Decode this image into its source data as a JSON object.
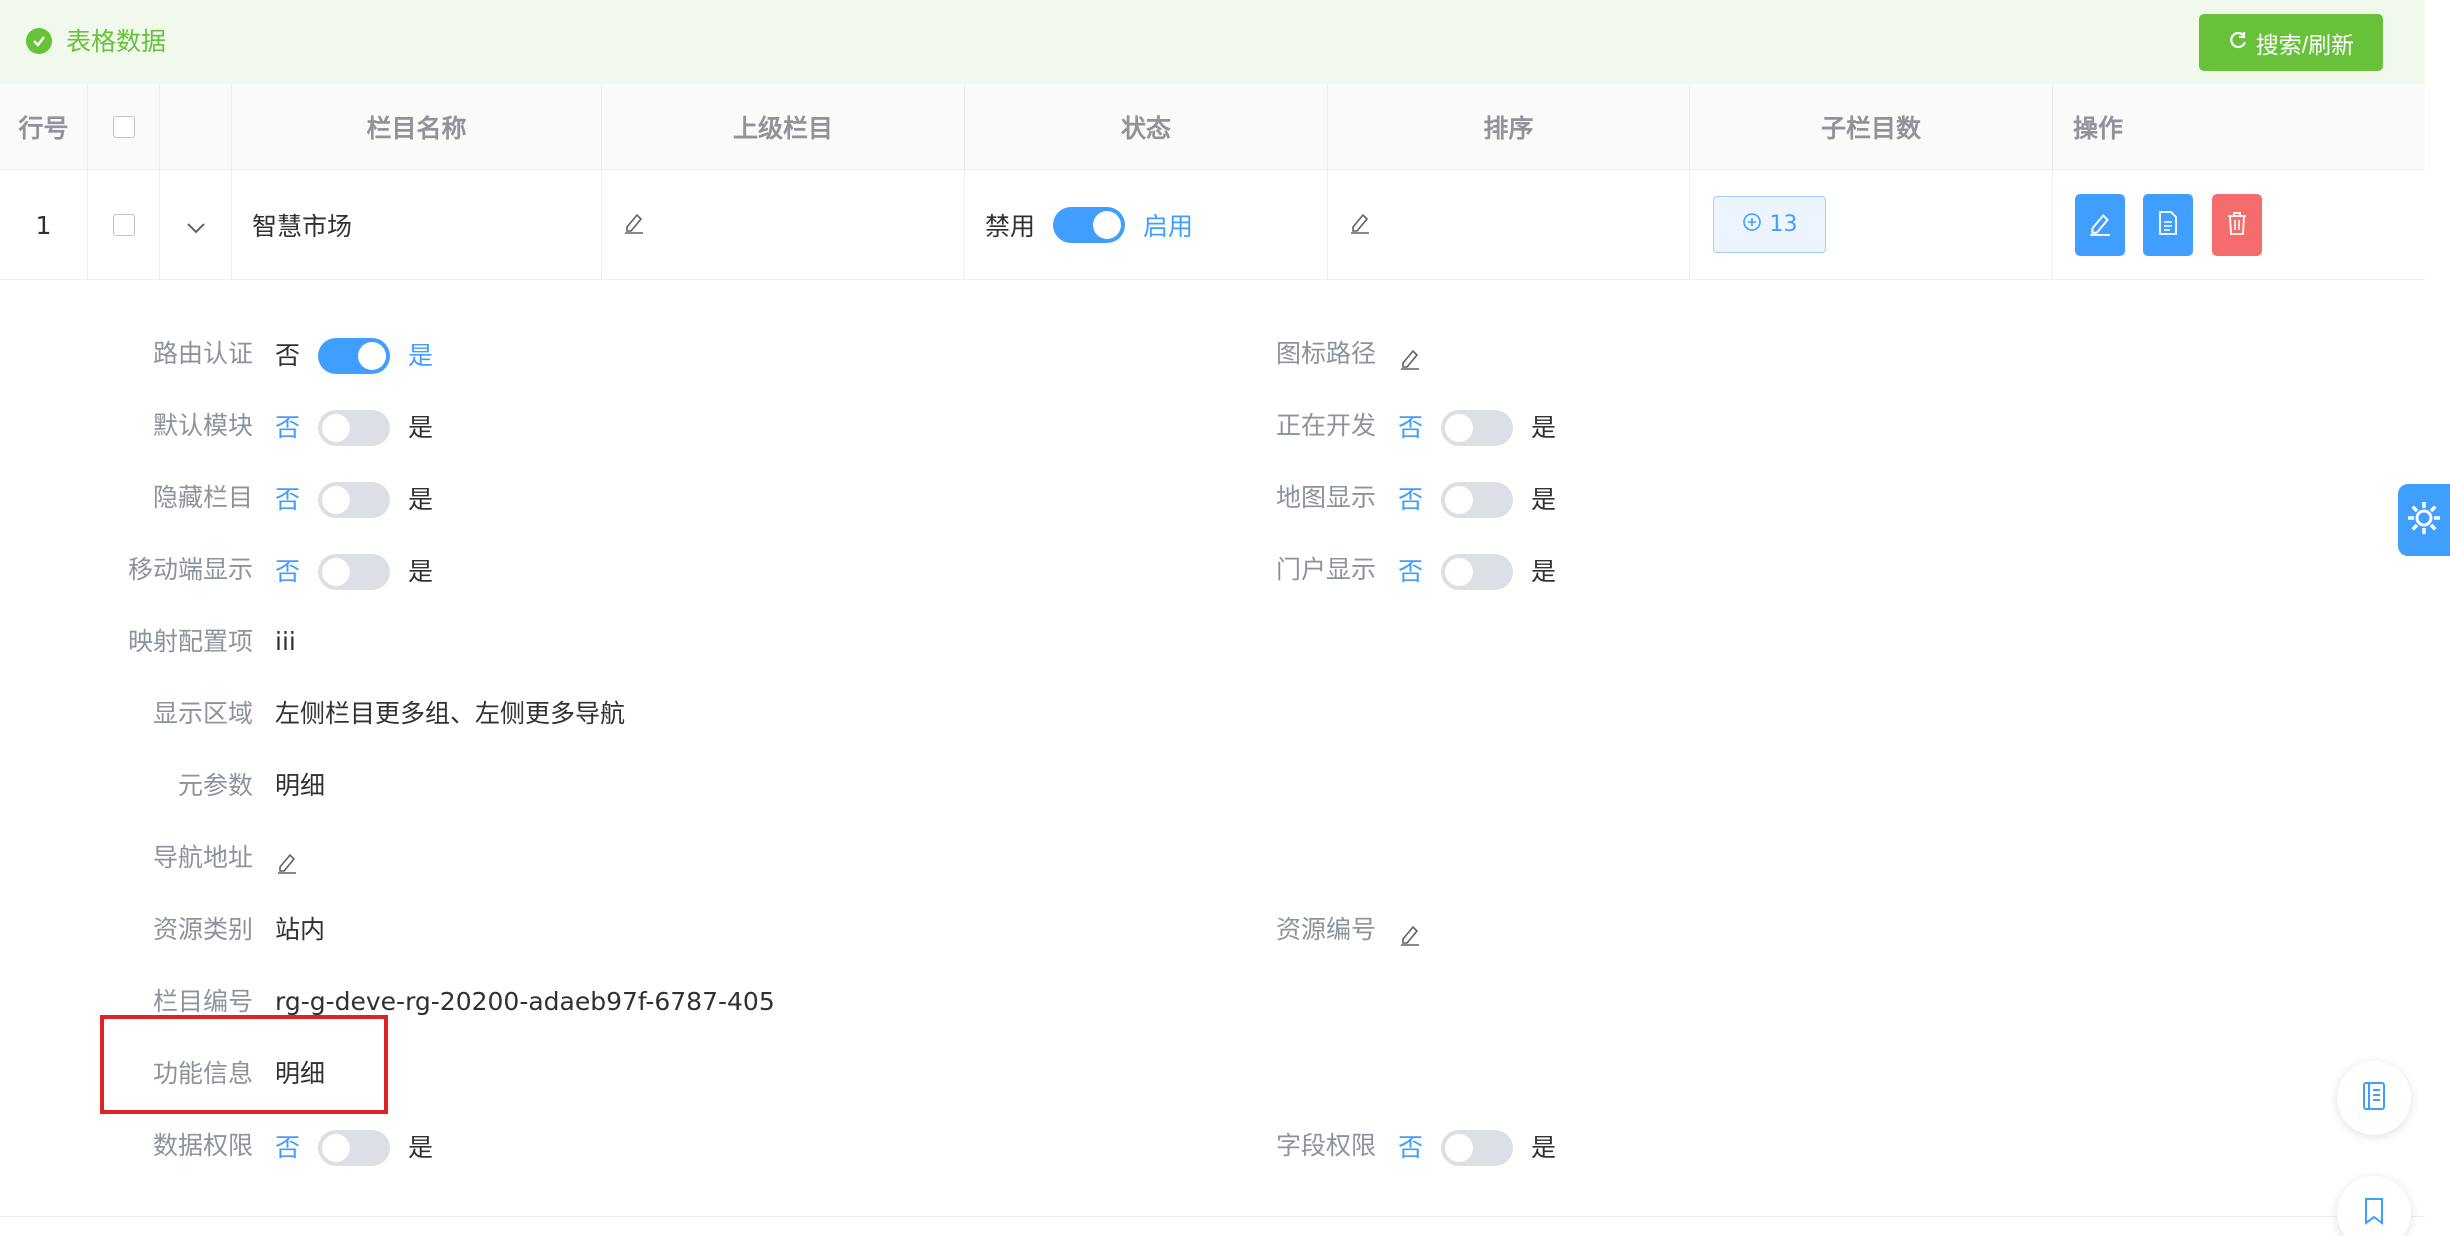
{
  "header": {
    "title": "表格数据",
    "refresh_label": "搜索/刷新"
  },
  "table": {
    "columns": [
      "行号",
      "栏目名称",
      "上级栏目",
      "状态",
      "排序",
      "子栏目数",
      "操作"
    ],
    "row": {
      "index": "1",
      "name": "智慧市场",
      "status_off": "禁用",
      "status_on": "启用",
      "child_count": "13"
    }
  },
  "detail": {
    "left": [
      {
        "label": "路由认证",
        "off": "否",
        "on": "是"
      },
      {
        "label": "默认模块",
        "off": "否",
        "on": "是"
      },
      {
        "label": "隐藏栏目",
        "off": "否",
        "on": "是"
      },
      {
        "label": "移动端显示",
        "off": "否",
        "on": "是"
      },
      {
        "label": "映射配置项",
        "value": "iii"
      },
      {
        "label": "显示区域",
        "value": "左侧栏目更多组、左侧更多导航"
      },
      {
        "label": "元参数",
        "value": "明细"
      },
      {
        "label": "导航地址"
      },
      {
        "label": "资源类别",
        "value": "站内"
      },
      {
        "label": "栏目编号",
        "value": "rg-g-deve-rg-20200-adaeb97f-6787-405"
      },
      {
        "label": "功能信息",
        "value": "明细"
      },
      {
        "label": "数据权限",
        "off": "否",
        "on": "是"
      }
    ],
    "right": [
      {
        "label": "图标路径"
      },
      {
        "label": "正在开发",
        "off": "否",
        "on": "是"
      },
      {
        "label": "地图显示",
        "off": "否",
        "on": "是"
      },
      {
        "label": "门户显示",
        "off": "否",
        "on": "是"
      },
      {
        "label": "资源编号"
      },
      {
        "label": "字段权限",
        "off": "否",
        "on": "是"
      }
    ]
  },
  "colors": {
    "primary": "#409eff",
    "success": "#67c23a",
    "danger": "#f56c6c",
    "highlight": "#e02424"
  }
}
